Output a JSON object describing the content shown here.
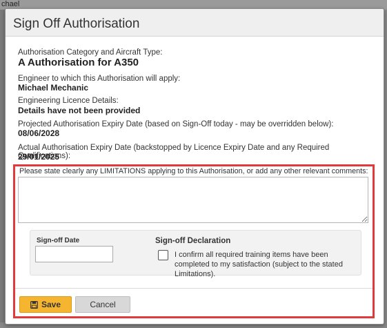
{
  "background": {
    "top_text": "chael"
  },
  "dialog": {
    "title": "Sign Off Authorisation"
  },
  "details": {
    "category_label": "Authorisation Category and Aircraft Type:",
    "category_value": "A Authorisation for A350",
    "engineer_label": "Engineer to which this Authorisation will apply:",
    "engineer_value": "Michael Mechanic",
    "licence_label": "Engineering Licence Details:",
    "licence_value": "Details have not been provided",
    "projected_label": "Projected Authorisation Expiry Date (based on Sign-Off today - may be overridden below):",
    "projected_value": "08/06/2028",
    "actual_label": "Actual Authorisation Expiry Date (backstopped by Licence Expiry Date and any Required Qualifications):",
    "actual_value": "29/01/2025"
  },
  "limitations": {
    "label": "Please state clearly any LIMITATIONS applying to this Authorisation, or add any other relevant comments:",
    "value": ""
  },
  "signoff": {
    "date_label": "Sign-off Date",
    "date_value": "",
    "declaration_title": "Sign-off Declaration",
    "declaration_text": "I confirm all required training items have been completed to my satisfaction (subject to the stated Limitations).",
    "declaration_checked": false
  },
  "actions": {
    "save_label": "Save",
    "cancel_label": "Cancel"
  },
  "colors": {
    "highlight_border": "#e03a3a",
    "save_button": "#f5b531",
    "cancel_button": "#d8d8d8"
  },
  "icons": {
    "save": "floppy-disk-icon"
  }
}
